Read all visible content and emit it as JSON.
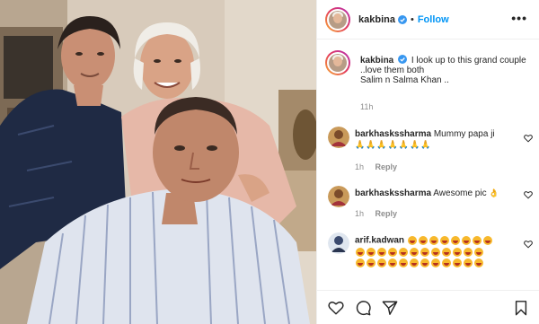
{
  "header": {
    "username": "kakbina",
    "separator": "•",
    "follow_label": "Follow",
    "more_label": "•••"
  },
  "caption": {
    "username": "kakbina",
    "line1": "I look up to this grand couple",
    "line2": "..love them both",
    "line3": "Salim n Salma Khan ..",
    "time": "11h"
  },
  "comments": [
    {
      "username": "barkhaskssharma",
      "text": "Mummy papa ji",
      "emoji_line": "🙏🙏🙏🙏🙏🙏🙏",
      "time": "1h",
      "reply": "Reply"
    },
    {
      "username": "barkhaskssharma",
      "text": "Awesome pic",
      "emoji_line": "👌",
      "time": "1h",
      "reply": "Reply"
    },
    {
      "username": "arif.kadwan",
      "text": "",
      "emoji_line": "😂😂😂😂😂😂😂😂😂😂😂😂😂😂😂😂😂😂😂😂😂😂😂😂😂😂😂",
      "time": "",
      "reply": ""
    }
  ],
  "icons": {
    "verified": "verified-badge-icon",
    "heart": "heart-icon",
    "comment": "comment-icon",
    "share": "share-icon",
    "save": "bookmark-icon"
  },
  "colors": {
    "accent": "#0095f6",
    "text": "#262626",
    "muted": "#8e8e8e"
  }
}
